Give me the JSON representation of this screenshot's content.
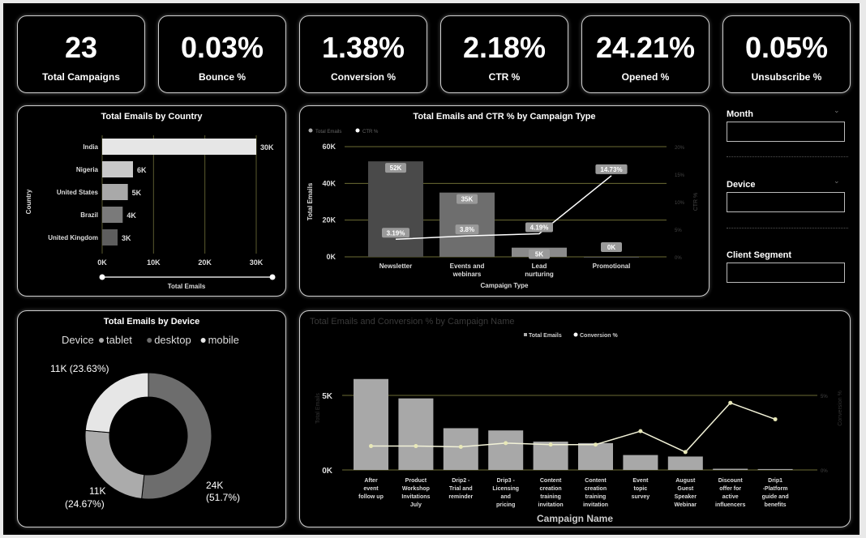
{
  "kpis": [
    {
      "value": "23",
      "label": "Total Campaigns"
    },
    {
      "value": "0.03%",
      "label": "Bounce %"
    },
    {
      "value": "1.38%",
      "label": "Conversion %"
    },
    {
      "value": "2.18%",
      "label": "CTR %"
    },
    {
      "value": "24.21%",
      "label": "Opened %"
    },
    {
      "value": "0.05%",
      "label": "Unsubscribe %"
    }
  ],
  "slicers": {
    "month_label": "Month",
    "device_label": "Device",
    "segment_label": "Client Segment"
  },
  "country_chart": {
    "title": "Total Emails by Country",
    "ylabel": "Country",
    "xlabel": "Total Emails",
    "ticks": [
      "0K",
      "10K",
      "20K",
      "30K"
    ]
  },
  "campaign_type_chart": {
    "title": "Total Emails and CTR % by Campaign Type",
    "legend": [
      "Total Emails",
      "CTR %"
    ],
    "ylabel": "Total Emails",
    "y2label": "CTR %",
    "xlabel": "Campaign Type",
    "yticks": [
      "0K",
      "20K",
      "40K",
      "60K"
    ],
    "y2ticks": [
      "20%",
      "15%",
      "10%",
      "5%",
      "0%"
    ]
  },
  "device_chart": {
    "title": "Total Emails by Device",
    "legend_title": "Device",
    "labels": [
      "11K (23.63%)",
      "24K",
      "(51.7%)",
      "11K",
      "(24.67%)"
    ]
  },
  "campaign_name_chart": {
    "title": "Total Emails and Conversion % by Campaign Name",
    "legend": [
      "Total Emails",
      "Conversion %"
    ],
    "ylabel": "Total Emails",
    "y2label": "Conversion %",
    "xlabel": "Campaign Name",
    "yticks": [
      "0K",
      "5K"
    ],
    "y2ticks": [
      "0%",
      "5%"
    ]
  },
  "chart_data": [
    {
      "type": "bar",
      "title": "Total Emails by Country",
      "categories": [
        "India",
        "Nigeria",
        "United States",
        "Brazil",
        "United Kingdom"
      ],
      "values": [
        30000,
        6000,
        5000,
        4000,
        3000
      ],
      "labels": [
        "30K",
        "6K",
        "5K",
        "4K",
        "3K"
      ],
      "xlabel": "Total Emails",
      "ylabel": "Country",
      "xlim": [
        0,
        30000
      ],
      "colors": [
        "#e6e6e6",
        "#c9c9c9",
        "#a9a9a9",
        "#7a7a7a",
        "#5e5e5e"
      ]
    },
    {
      "type": "bar",
      "title": "Total Emails and CTR % by Campaign Type",
      "categories": [
        "Newsletter",
        "Events and webinars",
        "Lead nurturing",
        "Promotional"
      ],
      "series": [
        {
          "name": "Total Emails",
          "values": [
            52000,
            35000,
            5000,
            0
          ],
          "labels": [
            "52K",
            "35K",
            "5K",
            "0K"
          ]
        },
        {
          "name": "CTR %",
          "values": [
            3.19,
            3.8,
            4.19,
            14.73
          ],
          "labels": [
            "3.19%",
            "3.8%",
            "4.19%",
            "14.73%"
          ]
        }
      ],
      "ylim": [
        0,
        60000
      ],
      "y2lim": [
        0,
        20
      ],
      "xlabel": "Campaign Type",
      "ylabel": "Total Emails",
      "y2label": "CTR %",
      "colors": [
        "#4a4a4a",
        "#6e6e6e",
        "#8a8a8a",
        "#555555"
      ]
    },
    {
      "type": "pie",
      "title": "Total Emails by Device",
      "categories": [
        "tablet",
        "desktop",
        "mobile"
      ],
      "values": [
        11000,
        24000,
        11000
      ],
      "percent": [
        24.67,
        51.7,
        23.63
      ],
      "colors": [
        "#ababab",
        "#6d6d6d",
        "#e6e6e6"
      ]
    },
    {
      "type": "bar",
      "title": "Total Emails and Conversion % by Campaign Name",
      "categories": [
        "After event follow up",
        "Product Workshop Invitations July",
        "Drip2 - Trial and reminder",
        "Drip3 - Licensing and pricing plan optio...",
        "Content creation training invitation ...",
        "Content creation training invitation J...",
        "Event topic survey",
        "August Guest Speaker Webinar I...",
        "Discount offer for active influencers",
        "Drip1 -Platform guide and benefits"
      ],
      "series": [
        {
          "name": "Total Emails",
          "values": [
            6100,
            4800,
            2800,
            2650,
            1900,
            1800,
            1000,
            900,
            80,
            60
          ]
        },
        {
          "name": "Conversion %",
          "values": [
            1.6,
            1.6,
            1.55,
            1.8,
            1.7,
            1.7,
            2.6,
            1.2,
            4.5,
            3.4
          ]
        }
      ],
      "ylim": [
        0,
        7000
      ],
      "y2lim": [
        0,
        7
      ],
      "xlabel": "Campaign Name",
      "colors": [
        "#b0b0b0",
        "#e8e8b8"
      ]
    }
  ]
}
